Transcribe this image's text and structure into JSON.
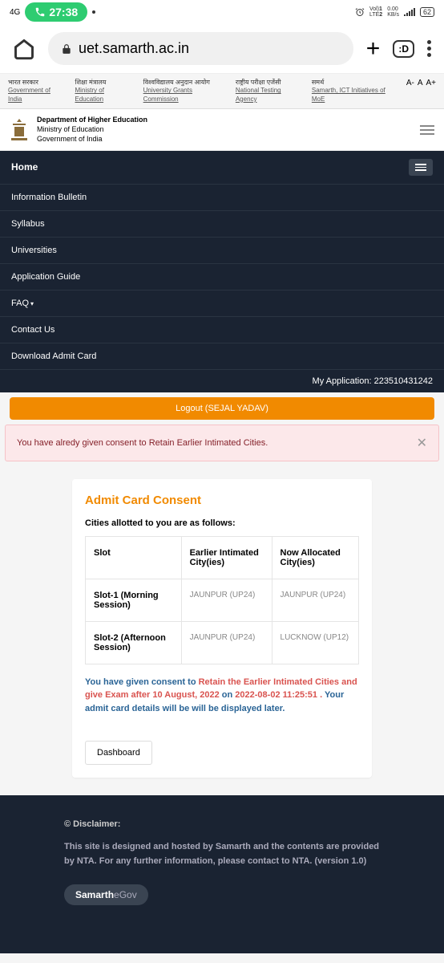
{
  "status": {
    "signal": "4G",
    "call_time": "27:38",
    "volte": "Vol)\nLTE",
    "net1": "1",
    "net2": "2",
    "speed": "0.00\nKB/s",
    "battery": "62"
  },
  "browser": {
    "url": "uet.samarth.ac.in",
    "tabs": ":D"
  },
  "gov_links": [
    {
      "hi": "भारत सरकार",
      "en": "Government of India"
    },
    {
      "hi": "शिक्षा मंत्रालय",
      "en": "Ministry of Education"
    },
    {
      "hi": "विश्वविद्यालय अनुदान आयोग",
      "en": "University Grants Commission"
    },
    {
      "hi": "राष्ट्रीय परीक्षा एजेंसी",
      "en": "National Testing Agency"
    },
    {
      "hi": "समर्थ",
      "en": "Samarth, ICT Initiatives of MoE"
    }
  ],
  "font_controls": {
    "minus": "A-",
    "normal": "A",
    "plus": "A+"
  },
  "dept": {
    "line1": "Department of Higher Education",
    "line2": "Ministry of Education",
    "line3": "Government of India"
  },
  "nav": {
    "home": "Home",
    "items": [
      "Information Bulletin",
      "Syllabus",
      "Universities",
      "Application Guide",
      "FAQ",
      "Contact Us",
      "Download Admit Card"
    ],
    "my_application_label": "My Application:",
    "my_application_no": "223510431242"
  },
  "logout": "Logout (SEJAL YADAV)",
  "alert": "You have alredy given consent to Retain Earlier Intimated Cities.",
  "card": {
    "title": "Admit Card Consent",
    "subtitle": "Cities allotted to you are as follows:",
    "headers": {
      "slot": "Slot",
      "earlier": "Earlier Intimated City(ies)",
      "now": "Now Allocated City(ies)"
    },
    "rows": [
      {
        "slot": "Slot-1 (Morning Session)",
        "earlier": "JAUNPUR (UP24)",
        "now": "JAUNPUR (UP24)"
      },
      {
        "slot": "Slot-2 (Afternoon Session)",
        "earlier": "JAUNPUR (UP24)",
        "now": "LUCKNOW (UP12)"
      }
    ],
    "consent_prefix": "You have given consent to ",
    "consent_red": "Retain the Earlier Intimated Cities and give Exam after 10 August, 2022",
    "consent_on": " on ",
    "consent_date": "2022-08-02 11:25:51 .",
    "consent_suffix": " Your admit card details will be will be displayed later.",
    "dashboard": "Dashboard"
  },
  "footer": {
    "disclaimer": "© Disclaimer:",
    "text": "This site is designed and hosted by Samarth and the contents are provided by NTA. For any further information, please contact to NTA. (version 1.0)",
    "badge_bold": "Samarth",
    "badge_light": "eGov"
  }
}
